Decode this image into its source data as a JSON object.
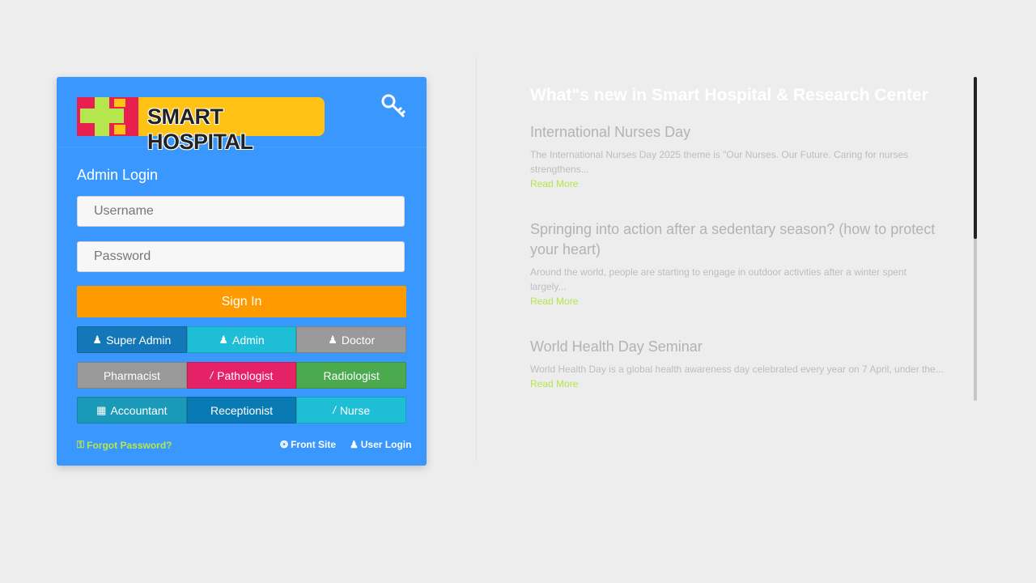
{
  "brand": {
    "logo_text": "SMART HOSPITAL",
    "color": "#3a97fd"
  },
  "login": {
    "title": "Admin Login",
    "username_placeholder": "Username",
    "password_placeholder": "Password",
    "sign_in_label": "Sign In",
    "key_icon": "key-icon"
  },
  "roles": {
    "row1": [
      "Super Admin",
      "Admin",
      "Doctor"
    ],
    "row2": [
      "Pharmacist",
      "Pathologist",
      "Radiologist"
    ],
    "row3": [
      "Accountant",
      "Receptionist",
      "Nurse"
    ]
  },
  "footer": {
    "forgot_password": "Forgot Password?",
    "front_site": "Front Site",
    "user_login": "User Login"
  },
  "news": {
    "heading": "What\"s new in Smart Hospital & Research Center",
    "items": [
      {
        "title": "International Nurses Day",
        "excerpt_1": "The International Nurses Day 2025 theme is \"Our Nurses. Our Future. Caring for nurses",
        "excerpt_2": "strengthens...",
        "read_more": "Read More"
      },
      {
        "title_1": "Springing into action after a sedentary season? (how to protect",
        "title_2": "your heart)",
        "excerpt_1": "Around the world, people are starting to engage in outdoor activities after a winter spent",
        "excerpt_2": "largely...",
        "read_more": "Read More"
      },
      {
        "title": "World Health Day Seminar",
        "excerpt_1": "World Health Day is a global health awareness day celebrated every year on 7 April, under the...",
        "read_more": "Read More"
      }
    ]
  }
}
